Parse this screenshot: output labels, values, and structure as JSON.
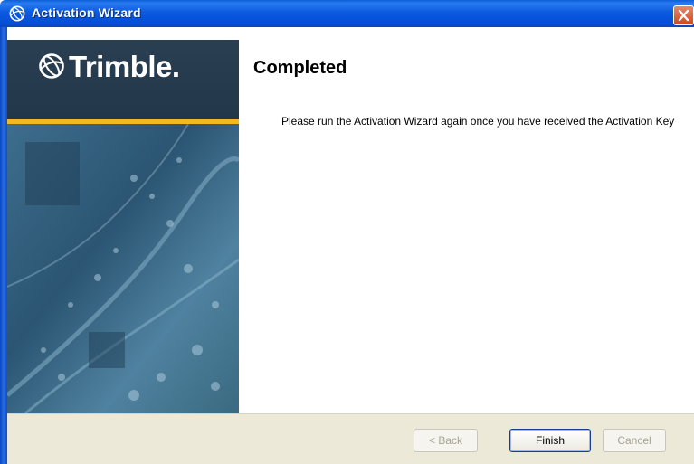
{
  "window": {
    "title": "Activation Wizard",
    "icons": {
      "app": "trimble-globe-icon",
      "close": "close-icon"
    }
  },
  "sidebar": {
    "brand": "Trimble."
  },
  "content": {
    "title": "Completed",
    "message": "Please run the Activation Wizard again once you have received the Activation Key"
  },
  "buttons": {
    "back": "< Back",
    "finish": "Finish",
    "cancel": "Cancel"
  },
  "colors": {
    "titlebar": "#0550d8",
    "accent_stripe": "#f3b81d",
    "brand_band": "#22374a",
    "button_bar": "#ece9d8"
  }
}
